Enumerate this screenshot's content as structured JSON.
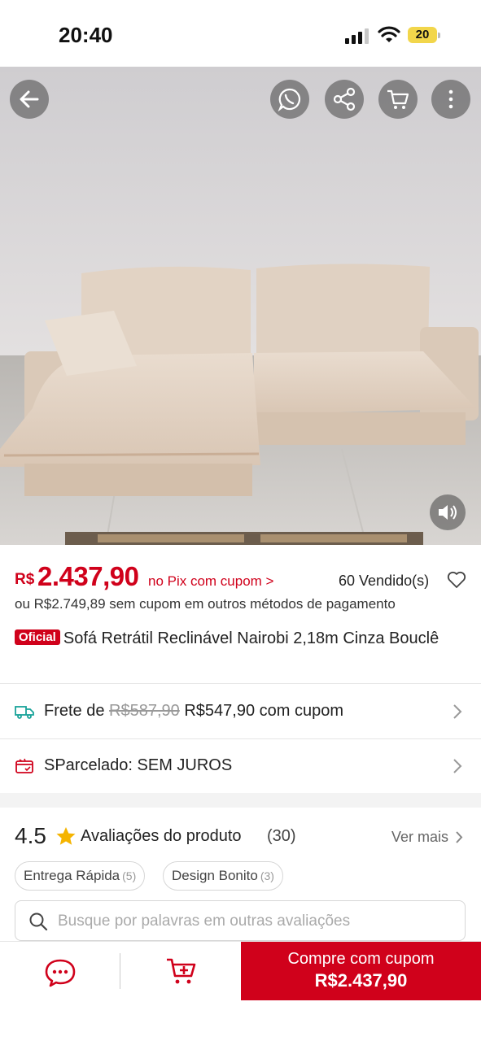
{
  "status_bar": {
    "time": "20:40",
    "battery": "20"
  },
  "top_actions": {
    "back_icon": "arrow-left",
    "whatsapp_icon": "whatsapp-share",
    "share_icon": "share-nodes",
    "cart_icon": "cart",
    "more_icon": "vertical-dots"
  },
  "price": {
    "currency": "R$",
    "value": "2.437,90",
    "pix_text": "no Pix com cupom >",
    "sold": "60 Vendido(s)",
    "alt_text": "ou R$2.749,89 sem cupom em outros métodos de pagamento"
  },
  "product": {
    "badge": "Oficial",
    "title": "Sofá Retrátil Reclinável Nairobi 2,18m Cinza Bouclê"
  },
  "shipping": {
    "label": "Frete de",
    "old_price": "R$587,90",
    "new_price": "R$547,90 com cupom"
  },
  "installments": {
    "label": "SParcelado: SEM JUROS"
  },
  "reviews": {
    "rating": "4.5",
    "title": "Avaliações do produto",
    "count": "(30)",
    "see_more": "Ver mais",
    "tags": [
      {
        "label": "Entrega Rápida",
        "count": "(5)"
      },
      {
        "label": "Design Bonito",
        "count": "(3)"
      }
    ],
    "search_placeholder": "Busque por palavras em outras avaliações"
  },
  "bottom_bar": {
    "buy_line1": "Compre com cupom",
    "buy_line2": "R$2.437,90"
  },
  "colors": {
    "accent": "#d0011b"
  }
}
